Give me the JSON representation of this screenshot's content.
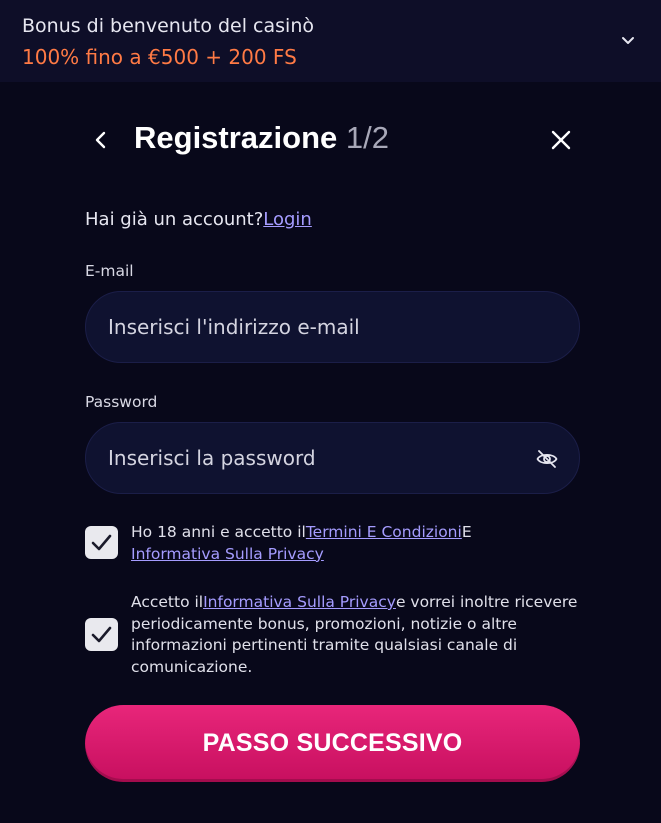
{
  "bonus": {
    "title": "Bonus di benvenuto del casinò",
    "offer": "100% fino a €500 + 200 FS"
  },
  "header": {
    "title": "Registrazione",
    "step": "1/2"
  },
  "login_prompt": {
    "text": "Hai già un account?",
    "link": "Login"
  },
  "email": {
    "label": "E-mail",
    "placeholder": "Inserisci l'indirizzo e-mail",
    "value": ""
  },
  "password": {
    "label": "Password",
    "placeholder": "Inserisci la password",
    "value": ""
  },
  "consent_terms": {
    "checked": true,
    "text_before": "Ho 18 anni e accetto il",
    "link1": "Termini E Condizioni",
    "text_middle": "E",
    "link2": "Informativa Sulla Privacy"
  },
  "consent_marketing": {
    "checked": true,
    "text_before": "Accetto il",
    "link": "Informativa Sulla Privacy",
    "text_after": "e vorrei inoltre ricevere periodicamente bonus, promozioni, notizie o altre informazioni pertinenti tramite qualsiasi canale di comunicazione."
  },
  "cta": {
    "label": "PASSO SUCCESSIVO"
  },
  "icons": {
    "bonus_toggle": "chevron-down-icon",
    "back": "chevron-left-icon",
    "close": "close-icon",
    "password_visibility": "eye-off-icon",
    "checkbox": "checkmark-icon"
  },
  "colors": {
    "background": "#08081a",
    "banner": "#0e0e28",
    "offer_accent": "#ff7a45",
    "link": "#a59cff",
    "input_bg": "#0f1230",
    "cta": "#e01b6f"
  }
}
